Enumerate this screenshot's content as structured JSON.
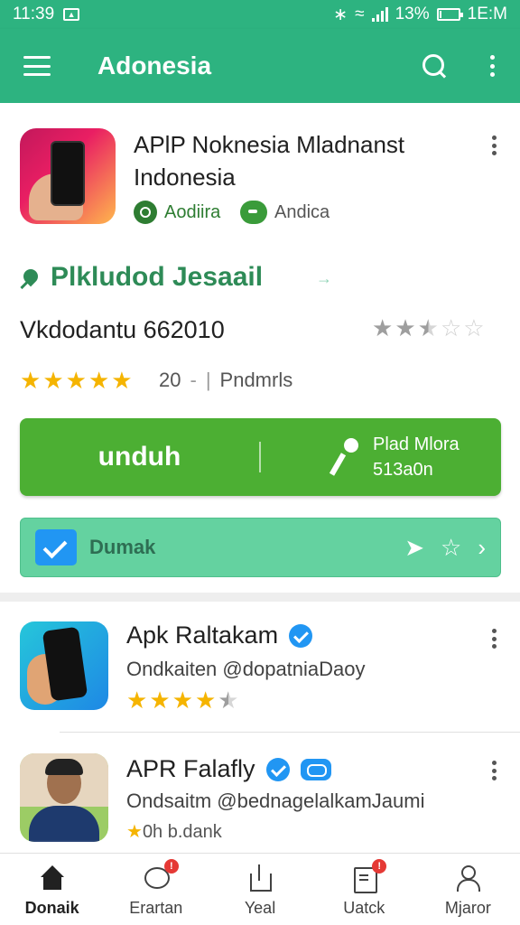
{
  "status_bar": {
    "time": "11:39",
    "right_text": "✳ ← ✳",
    "battery_text": "13%",
    "clock_right": "1E:M",
    "battery_level": 0.13
  },
  "toolbar": {
    "title": "Adonesia"
  },
  "app": {
    "title": "APlP Noknesia Mladnanst Indonesia",
    "dev_a": "Aodiira",
    "dev_b": "Andica",
    "section_title": "Plkludod Jesaail",
    "section_arrow": "→",
    "version": "Vkdodantu 662010",
    "right_rating": 2.5,
    "left_rating": 5,
    "rating_count": "20",
    "rating_sep": "-",
    "rating_pipe": "|",
    "rating_label": "Pndmrls",
    "install_label": "unduh",
    "install_side_line1": "Plad Mlora",
    "install_side_line2": "513a0n",
    "save_label": "Dumak"
  },
  "list": [
    {
      "name": "Apk Raltakam",
      "handle": "Ondkaiten @dopatniaDaoy",
      "rating": 4.5,
      "verified": true
    },
    {
      "name": "APR Falafly",
      "handle": "Ondsaitm @bednagelalkamJaumi",
      "sub": "0h b.dank",
      "verified": true
    }
  ],
  "nav": [
    {
      "label": "Donaik",
      "icon": "home-icon",
      "active": true
    },
    {
      "label": "Erartan",
      "icon": "chat-icon",
      "badge": "!"
    },
    {
      "label": "Yeal",
      "icon": "share-icon"
    },
    {
      "label": "Uatck",
      "icon": "doc-icon",
      "badge": "!"
    },
    {
      "label": "Mjaror",
      "icon": "user-icon"
    }
  ],
  "colors": {
    "brand": "#2db380",
    "install": "#4caf33",
    "save_bar": "#64d2a0",
    "star": "#f5b400",
    "section": "#2e8b57"
  }
}
